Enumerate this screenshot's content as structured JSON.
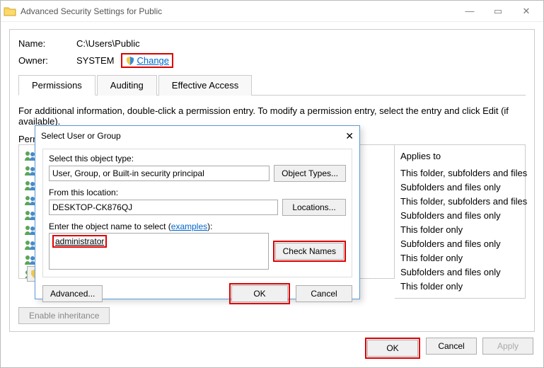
{
  "titlebar": {
    "title": "Advanced Security Settings for Public"
  },
  "info": {
    "name_label": "Name:",
    "name_value": "C:\\Users\\Public",
    "owner_label": "Owner:",
    "owner_value": "SYSTEM",
    "change_label": "Change"
  },
  "tabs": {
    "permissions": "Permissions",
    "auditing": "Auditing",
    "effective": "Effective Access"
  },
  "description": "For additional information, double-click a permission entry. To modify a permission entry, select the entry and click Edit (if available).",
  "perm_label": "Perm",
  "applies_header": "Applies to",
  "applies": [
    "This folder, subfolders and files",
    "Subfolders and files only",
    "This folder, subfolders and files",
    "Subfolders and files only",
    "This folder only",
    "Subfolders and files only",
    "This folder only",
    "Subfolders and files only",
    "This folder only"
  ],
  "enable_btn": "Enable inheritance",
  "footer": {
    "ok": "OK",
    "cancel": "Cancel",
    "apply": "Apply"
  },
  "dlg": {
    "title": "Select User or Group",
    "obj_type_label": "Select this object type:",
    "obj_type_value": "User, Group, or Built-in security principal",
    "obj_types_btn": "Object Types...",
    "loc_label": "From this location:",
    "loc_value": "DESKTOP-CK876QJ",
    "loc_btn": "Locations...",
    "name_label": "Enter the object name to select (",
    "examples": "examples",
    "name_label_end": "):",
    "name_value": "administrator",
    "check_btn": "Check Names",
    "advanced_btn": "Advanced...",
    "ok": "OK",
    "cancel": "Cancel"
  }
}
